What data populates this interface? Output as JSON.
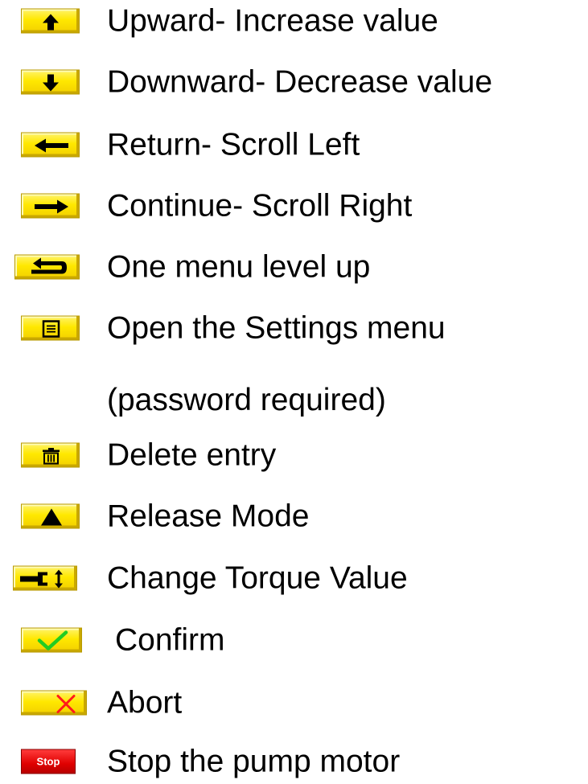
{
  "legend": {
    "items": [
      {
        "icon": "arrow-up-icon",
        "label": "Upward- Increase value"
      },
      {
        "icon": "arrow-down-icon",
        "label": "Downward- Decrease value"
      },
      {
        "icon": "arrow-left-icon",
        "label": "Return- Scroll Left"
      },
      {
        "icon": "arrow-right-icon",
        "label": "Continue- Scroll Right"
      },
      {
        "icon": "return-up-icon",
        "label": "One menu level up"
      },
      {
        "icon": "menu-list-icon",
        "label": "Open the Settings menu",
        "label_line2": "(password required)"
      },
      {
        "icon": "trash-icon",
        "label": "Delete entry"
      },
      {
        "icon": "triangle-up-icon",
        "label": "Release Mode"
      },
      {
        "icon": "torque-wrench-icon",
        "label": "Change Torque Value"
      },
      {
        "icon": "checkmark-icon",
        "label": "Confirm"
      },
      {
        "icon": "x-icon",
        "label": "Abort"
      },
      {
        "icon": "stop-button",
        "label": "Stop the pump motor",
        "button_text": "Stop"
      }
    ]
  },
  "colors": {
    "key_yellow": "#ffe800",
    "stop_red": "#e00000",
    "check_green": "#22cc22",
    "abort_red": "#ff1a1a"
  }
}
